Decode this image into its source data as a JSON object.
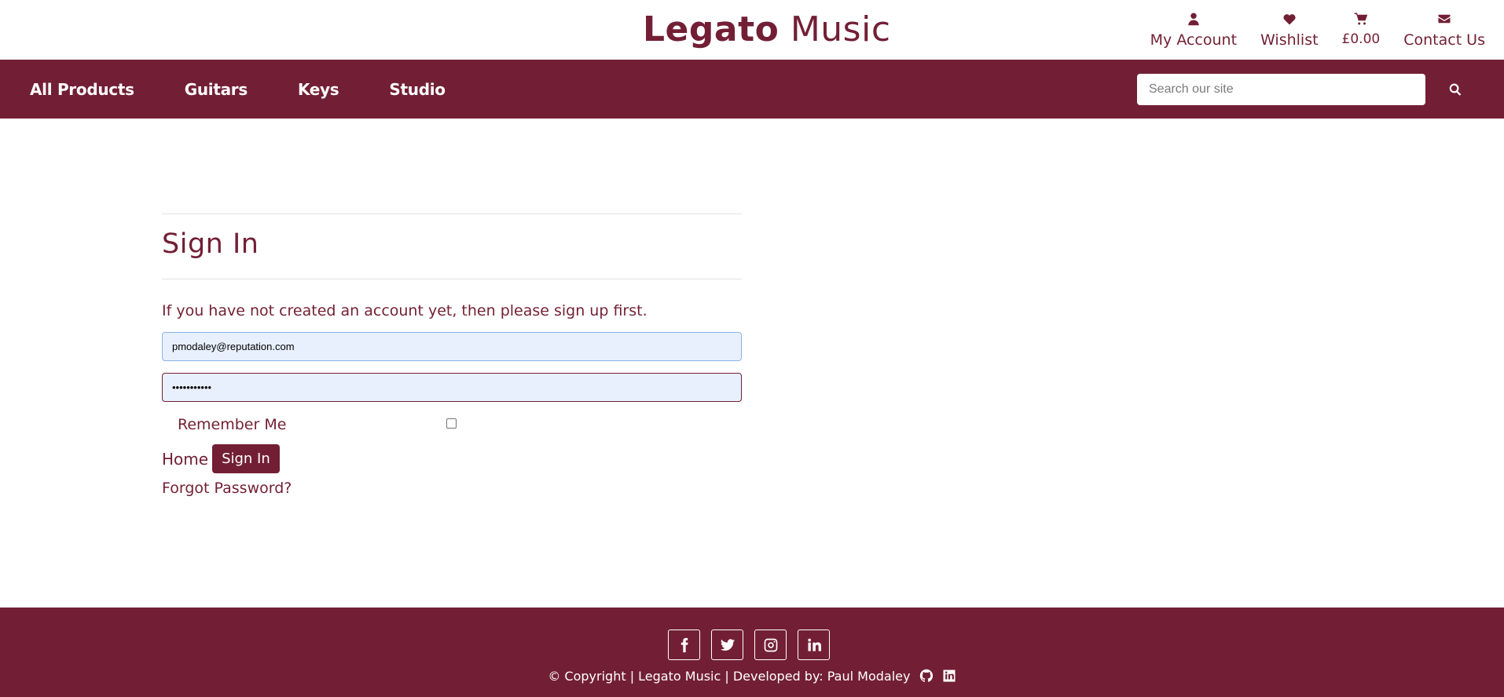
{
  "brand": {
    "bold": "Legato",
    "light": "Music"
  },
  "top_links": [
    {
      "label": "My Account",
      "icon": "user-icon"
    },
    {
      "label": "Wishlist",
      "icon": "heart-icon"
    },
    {
      "label": "£0.00",
      "icon": "cart-icon"
    },
    {
      "label": "Contact Us",
      "icon": "envelope-icon"
    }
  ],
  "nav": {
    "items": [
      "All Products",
      "Guitars",
      "Keys",
      "Studio"
    ],
    "search_placeholder": "Search our site"
  },
  "signin": {
    "title": "Sign In",
    "intro": "If you have not created an account yet, then please sign up first.",
    "email_value": "pmodaley@reputation.com",
    "password_value": "•••••••••••",
    "remember_label": "Remember Me",
    "home_label": "Home",
    "submit_label": "Sign In",
    "forgot_label": "Forgot Password?"
  },
  "footer": {
    "social_icons": [
      "facebook-icon",
      "twitter-icon",
      "instagram-icon",
      "linkedin-icon"
    ],
    "copyright": "© Copyright | Legato Music | Developed by: Paul Modaley"
  },
  "colors": {
    "primary": "#721f35",
    "autofill": "#e8f0fe"
  }
}
